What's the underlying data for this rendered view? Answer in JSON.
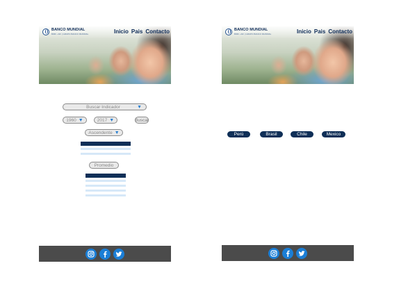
{
  "header": {
    "brand": "BANCO MUNDIAL",
    "brand_sub": "BIRF • AIF | GRUPO BANCO MUNDIAL",
    "nav": [
      "Inicio",
      "Pais",
      "Contacto"
    ]
  },
  "indicator_screen": {
    "search_placeholder": "Buscar Indicador",
    "year_from": "1960",
    "year_to": "2017",
    "search_button": "Buscar",
    "order": "Ascendente",
    "average_button": "Promedio"
  },
  "country_screen": {
    "countries": [
      "Perú",
      "Brasil",
      "Chile",
      "Mexico"
    ]
  },
  "footer": {
    "icons": [
      "instagram-icon",
      "facebook-icon",
      "twitter-icon"
    ]
  },
  "colors": {
    "navy": "#0f2f57",
    "light_row": "#d6e8f8",
    "accent_blue": "#1b7ed6",
    "footer_gray": "#4b4b4b",
    "pill_gray": "#e9e9e9"
  }
}
